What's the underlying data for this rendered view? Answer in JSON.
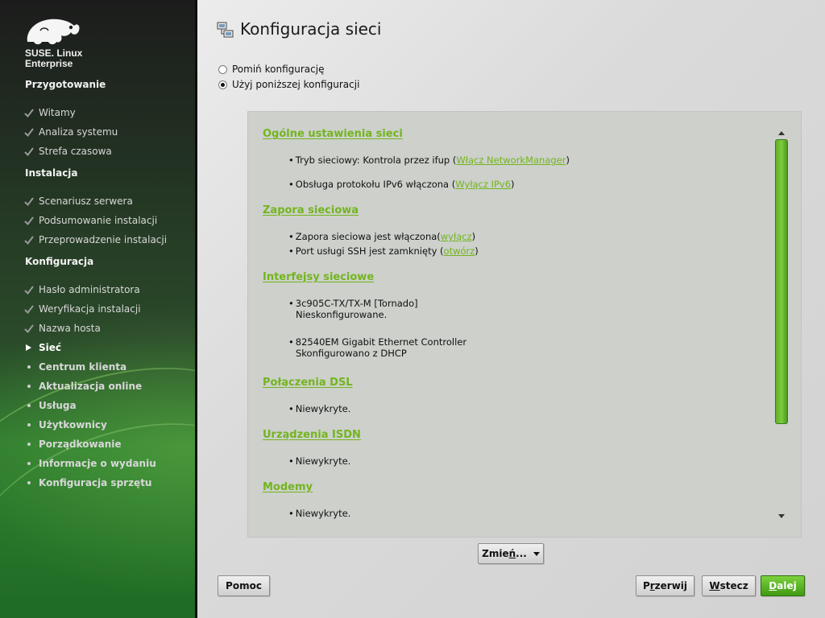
{
  "brand": {
    "line1": "SUSE. Linux",
    "line2": "Enterprise",
    "logo_icon": "chameleon-logo"
  },
  "sidebar": {
    "sections": [
      {
        "title": "Przygotowanie"
      },
      {
        "title": "Instalacja"
      },
      {
        "title": "Konfiguracja"
      }
    ],
    "steps": [
      {
        "label": "Witamy",
        "state": "done"
      },
      {
        "label": "Analiza systemu",
        "state": "done"
      },
      {
        "label": "Strefa czasowa",
        "state": "done"
      },
      {
        "label": "Scenariusz serwera",
        "state": "done"
      },
      {
        "label": "Podsumowanie instalacji",
        "state": "done"
      },
      {
        "label": "Przeprowadzenie instalacji",
        "state": "done"
      },
      {
        "label": "Hasło administratora",
        "state": "done"
      },
      {
        "label": "Weryfikacja instalacji",
        "state": "done"
      },
      {
        "label": "Nazwa hosta",
        "state": "done"
      },
      {
        "label": "Sieć",
        "state": "current"
      },
      {
        "label": "Centrum klienta",
        "state": "pending"
      },
      {
        "label": "Aktualizacja online",
        "state": "pending"
      },
      {
        "label": "Usługa",
        "state": "pending"
      },
      {
        "label": "Użytkownicy",
        "state": "pending"
      },
      {
        "label": "Porządkowanie",
        "state": "pending"
      },
      {
        "label": "Informacje o wydaniu",
        "state": "pending"
      },
      {
        "label": "Konfiguracja sprzętu",
        "state": "pending"
      }
    ]
  },
  "main": {
    "title": "Konfiguracja sieci",
    "title_icon": "network-config-icon",
    "options": [
      {
        "label": "Pomiń konfigurację",
        "checked": false
      },
      {
        "label": "Użyj poniższej konfiguracji",
        "checked": true
      }
    ],
    "sections": [
      {
        "title": "Ogólne ustawienia sieci",
        "items": [
          {
            "text": "Tryb sieciowy: Kontrola przez ifup (",
            "link": "Włącz NetworkManager",
            "after": ")"
          },
          {
            "text": "Obsługa protokołu IPv6 włączona (",
            "link": "Wyłącz IPv6",
            "after": ")"
          }
        ]
      },
      {
        "title": "Zapora sieciowa",
        "items": [
          {
            "text": "Zapora sieciowa jest włączona(",
            "link": "wyłącz",
            "after": ")"
          },
          {
            "text": "Port usługi SSH jest zamknięty (",
            "link": "otwórz",
            "after": ")"
          }
        ]
      },
      {
        "title": "Interfejsy sieciowe",
        "items": [
          {
            "text": "3c905C-TX/TX-M [Tornado]",
            "sub": "Nieskonfigurowane."
          },
          {
            "text": "82540EM Gigabit Ethernet Controller",
            "sub": "Skonfigurowano z DHCP"
          }
        ]
      },
      {
        "title": "Połączenia DSL",
        "items": [
          {
            "text": "Niewykryte."
          }
        ]
      },
      {
        "title": "Urządzenia ISDN",
        "items": [
          {
            "text": "Niewykryte."
          }
        ]
      },
      {
        "title": "Modemy",
        "items": [
          {
            "text": "Niewykryte."
          }
        ]
      }
    ],
    "change_button": {
      "label_prefix": "Zmie",
      "label_hot": "ń",
      "label_suffix": "..."
    }
  },
  "footer": {
    "help": "Pomoc",
    "abort": {
      "hot": "r",
      "pre": "P",
      "post": "zerwij"
    },
    "back": {
      "hot": "W",
      "post": "stecz"
    },
    "next": {
      "hot": "D",
      "post": "alej"
    }
  },
  "colors": {
    "accent_green": "#73b51e",
    "primary_button": "#3f9a14"
  }
}
